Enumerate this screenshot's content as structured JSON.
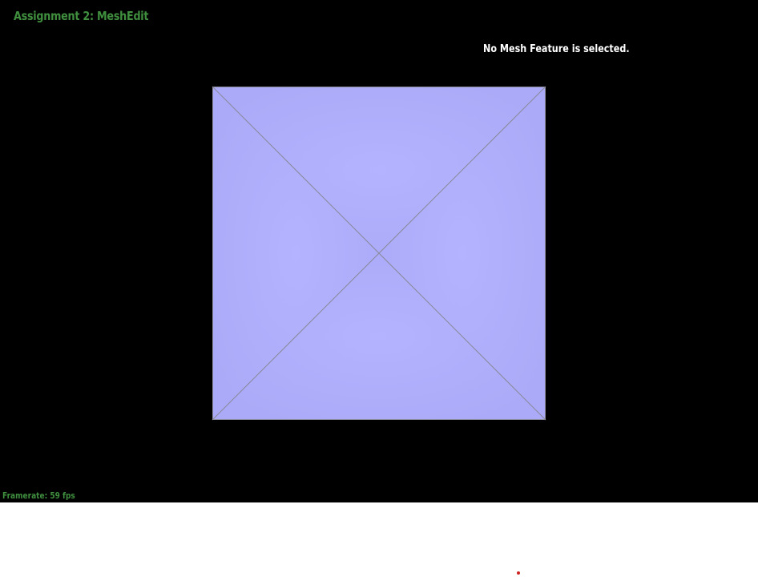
{
  "app": {
    "title": "Assignment 2: MeshEdit"
  },
  "status": {
    "selection_text": "No Mesh Feature is selected.",
    "framerate_text": "Framerate: 59 fps"
  },
  "colors": {
    "viewport_background": "#000000",
    "title_text": "#3f8f3f",
    "framerate_text": "#3f8f3f",
    "status_text": "#ffffff",
    "mesh_face": "#b0b0ff",
    "mesh_edge": "#8a8a99",
    "cursor_dot": "#cc2222"
  }
}
